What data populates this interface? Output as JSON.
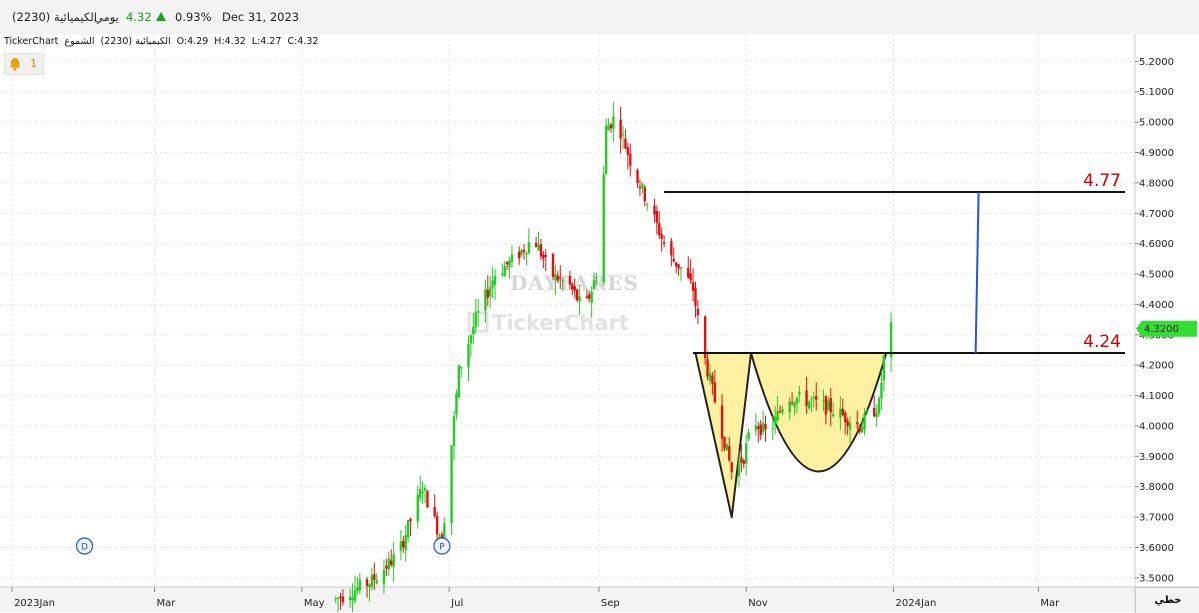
{
  "header": {
    "symbol_name": "الكيميائية (2230)",
    "period": "يومي",
    "last_price": "4.32",
    "change_pct": "0.93%",
    "date": "Dec 31, 2023",
    "up_color": "#1aa01a"
  },
  "ohlc_bar": {
    "brand": "TickerChart",
    "symbol": "الكيميائية (2230)",
    "type": "الشموع",
    "open": "O:4.29",
    "high": "H:4.32",
    "low": "L:4.27",
    "close": "C:4.32"
  },
  "alert": {
    "icon": "bell-icon",
    "count": "1"
  },
  "watermark": {
    "line1": "DAYFARES",
    "line2": "TickerChart"
  },
  "corner_label": "خطي",
  "markers": [
    {
      "letter": "D",
      "date": "2023-01-31"
    },
    {
      "letter": "P",
      "date": "2023-06-28"
    }
  ],
  "chart_data": {
    "type": "candlestick",
    "x_axis": {
      "range": [
        "2022-12-27",
        "2024-04-10"
      ],
      "tick_labels": [
        {
          "label": "2023Jan",
          "date": "2023-01-01"
        },
        {
          "label": "Mar",
          "date": "2023-03-01"
        },
        {
          "label": "May",
          "date": "2023-05-01"
        },
        {
          "label": "Jul",
          "date": "2023-07-01"
        },
        {
          "label": "Sep",
          "date": "2023-09-01"
        },
        {
          "label": "Nov",
          "date": "2023-11-01"
        },
        {
          "label": "2024Jan",
          "date": "2024-01-01"
        },
        {
          "label": "Mar",
          "date": "2024-03-01"
        }
      ]
    },
    "y_axis": {
      "range": [
        3.47,
        5.29
      ],
      "ticks": [
        "3.5000",
        "3.6000",
        "3.7000",
        "3.8000",
        "3.9000",
        "4.0000",
        "4.1000",
        "4.2000",
        "4.3000",
        "4.4000",
        "4.5000",
        "4.6000",
        "4.7000",
        "4.8000",
        "4.9000",
        "5.0000",
        "5.1000",
        "5.2000"
      ]
    },
    "last_price_label": "4.3200",
    "colors": {
      "up": "#22cc22",
      "down": "#dd1111"
    },
    "price_path": [
      [
        "2023-05-15",
        3.43
      ],
      [
        "2023-05-30",
        3.49
      ],
      [
        "2023-06-10",
        3.58
      ],
      [
        "2023-06-20",
        3.8
      ],
      [
        "2023-06-28",
        3.62
      ],
      [
        "2023-07-05",
        4.18
      ],
      [
        "2023-07-12",
        4.35
      ],
      [
        "2023-07-20",
        4.5
      ],
      [
        "2023-07-28",
        4.55
      ],
      [
        "2023-08-05",
        4.62
      ],
      [
        "2023-08-12",
        4.5
      ],
      [
        "2023-08-20",
        4.46
      ],
      [
        "2023-08-26",
        4.38
      ],
      [
        "2023-09-01",
        4.52
      ],
      [
        "2023-09-04",
        4.98
      ],
      [
        "2023-09-08",
        5.02
      ],
      [
        "2023-09-15",
        4.85
      ],
      [
        "2023-09-22",
        4.72
      ],
      [
        "2023-09-30",
        4.56
      ],
      [
        "2023-10-05",
        4.52
      ],
      [
        "2023-10-10",
        4.45
      ],
      [
        "2023-10-14",
        4.25
      ],
      [
        "2023-10-20",
        4.05
      ],
      [
        "2023-10-26",
        3.85
      ],
      [
        "2023-10-31",
        3.9
      ],
      [
        "2023-11-04",
        4.02
      ],
      [
        "2023-11-10",
        3.97
      ],
      [
        "2023-11-18",
        4.1
      ],
      [
        "2023-11-28",
        4.08
      ],
      [
        "2023-12-08",
        4.05
      ],
      [
        "2023-12-18",
        4.0
      ],
      [
        "2023-12-26",
        4.07
      ],
      [
        "2023-12-29",
        4.3
      ],
      [
        "2023-12-31",
        4.32
      ]
    ],
    "annotations": {
      "target_line": {
        "label": "4.77",
        "value": 4.77,
        "from": "2023-09-28",
        "color": "#cc0000"
      },
      "neckline": {
        "label": "4.24",
        "value": 4.24,
        "from": "2023-10-10",
        "color": "#cc0000"
      },
      "measure_arrow": {
        "date": "2024-02-04",
        "from": 4.24,
        "to": 4.77,
        "color": "#2255dd"
      },
      "pattern_fill": "#fdf0a0",
      "v_shape": [
        [
          "2023-10-11",
          4.24
        ],
        [
          "2023-10-26",
          3.7
        ],
        [
          "2023-11-03",
          4.24
        ]
      ],
      "cup": {
        "start": [
          "2023-11-03",
          4.24
        ],
        "bottom": [
          "2023-11-29",
          3.85
        ],
        "end": [
          "2023-12-29",
          4.24
        ]
      }
    }
  }
}
